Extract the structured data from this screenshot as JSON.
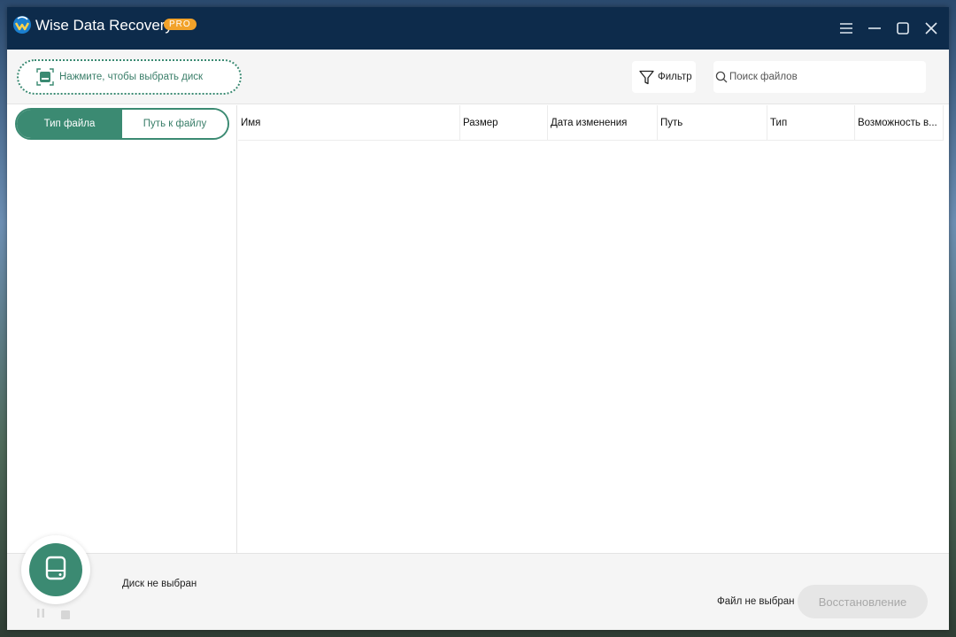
{
  "titlebar": {
    "app_title": "Wise Data Recovery",
    "badge": "PRO",
    "icons": [
      "app-logo-icon",
      "menu-icon",
      "minimize-icon",
      "maximize-icon",
      "close-icon"
    ]
  },
  "toolbar": {
    "disk_select_label": "Нажмите, чтобы выбрать диск",
    "filter_label": "Фильтр",
    "search_placeholder": "Поиск файлов"
  },
  "left_panel": {
    "tabs": [
      {
        "label": "Тип файла",
        "active": true
      },
      {
        "label": "Путь к файлу",
        "active": false
      }
    ]
  },
  "table": {
    "columns": [
      "Имя",
      "Размер",
      "Дата изменения",
      "Путь",
      "Тип",
      "Возможность в..."
    ],
    "rows": []
  },
  "bottom": {
    "disk_status": "Диск не выбран",
    "file_status": "Файл не выбран",
    "restore_label": "Восстановление"
  },
  "colors": {
    "titlebar": "#0d2b4b",
    "accent": "#3b8a72",
    "badge": "#f2a22a",
    "disabled_button": "#e6e6e6"
  }
}
